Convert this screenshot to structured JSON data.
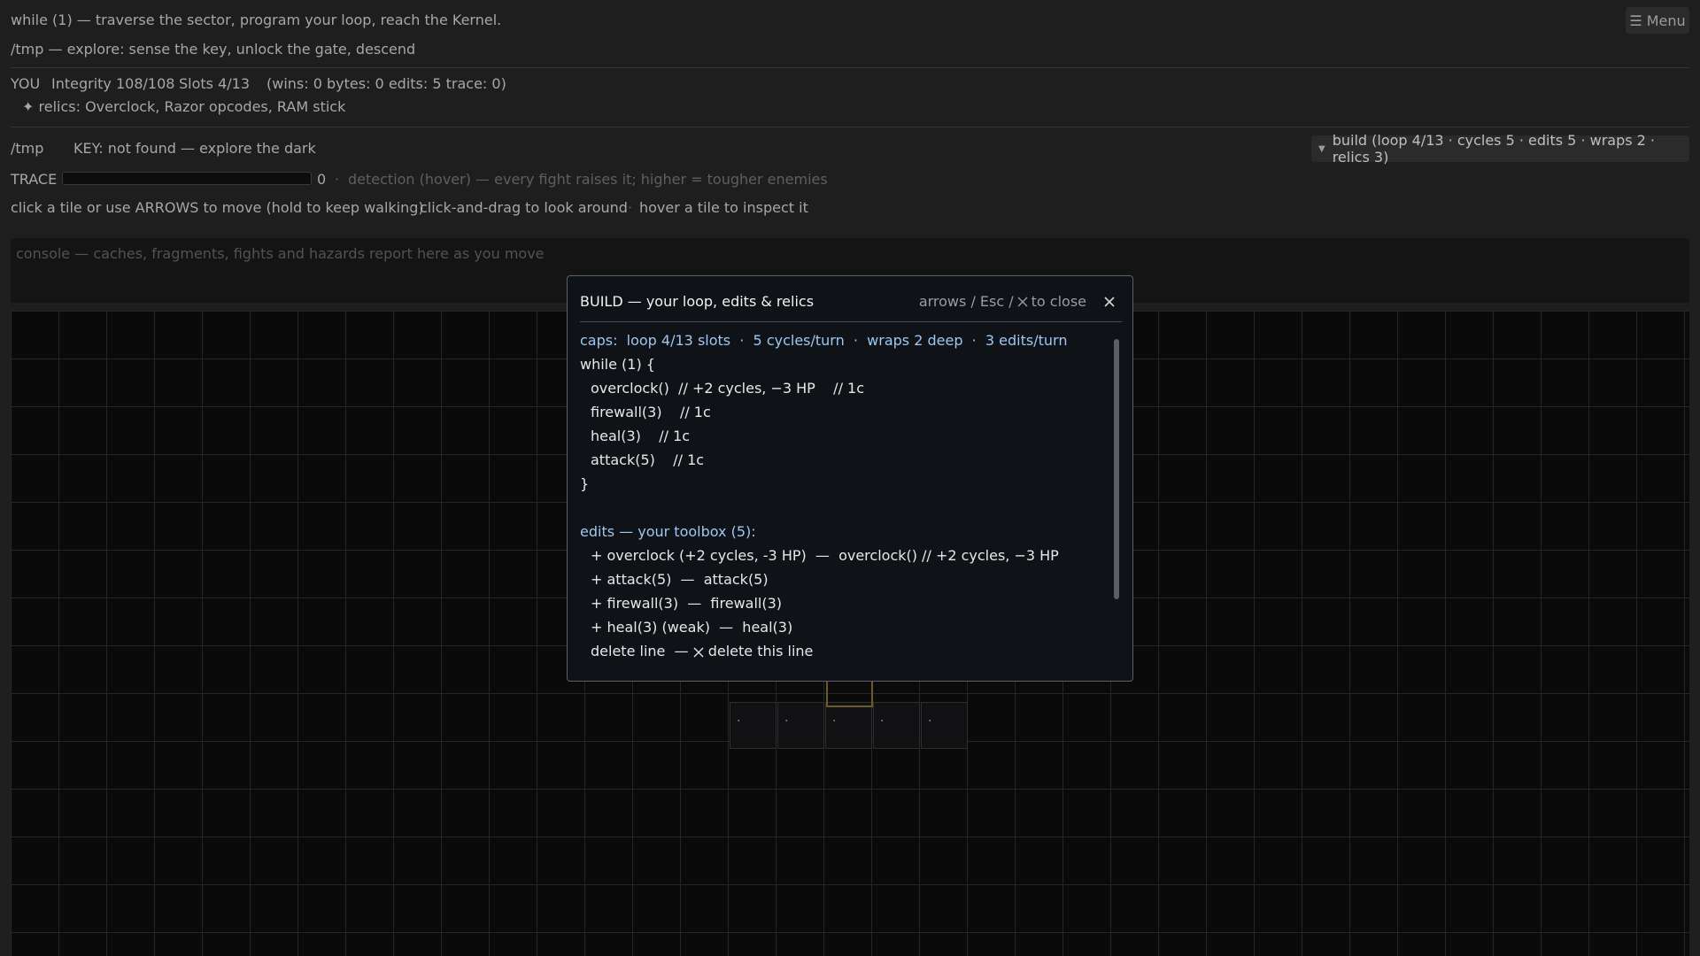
{
  "header": {
    "title_line": "while (1)  —  traverse the sector, program your loop, reach the Kernel.",
    "subtitle_line": "/tmp — explore: sense the key, unlock the gate, descend",
    "menu_label": "Menu"
  },
  "status": {
    "you": "YOU",
    "integrity": "Integrity 108/108",
    "slots": "Slots 4/13",
    "counters": "(wins: 0   bytes: 0   edits: 5   trace: 0)",
    "relics": "relics: Overclock, Razor opcodes, RAM stick"
  },
  "location": {
    "path": "/tmp",
    "key_status": "KEY: not found — explore the dark",
    "build_toggle": "build (loop 4/13 · cycles 5 · edits 5 · wraps 2 · relics 3)"
  },
  "trace": {
    "label": "TRACE",
    "value": "0",
    "level": 0,
    "hint": "detection (hover) — every fight raises it; higher = tougher enemies"
  },
  "help": {
    "move": "click a tile or use ARROWS to move (hold to keep walking)",
    "look": "click-and-drag to look around",
    "inspect": "hover a tile to inspect it",
    "sep": "·"
  },
  "console": {
    "placeholder": "console — caches, fragments, fights and hazards report here as you move"
  },
  "map": {
    "dots": [
      ".",
      ".",
      ".",
      ".",
      "."
    ]
  },
  "modal": {
    "title": "BUILD — your loop, edits & relics",
    "hint_prefix": "arrows / Esc /",
    "hint_suffix": "to close",
    "caps": "caps:  loop 4/13 slots  ·  5 cycles/turn  ·  wraps 2 deep  ·  3 edits/turn",
    "loop_open": "while (1) {",
    "loop_lines": [
      "overclock()  // +2 cycles, −3 HP    // 1c",
      "firewall(3)    // 1c",
      "heal(3)    // 1c",
      "attack(5)    // 1c"
    ],
    "loop_close": "}",
    "edits_header": "edits — your toolbox (5):",
    "edits": [
      "+ overclock (+2 cycles, -3 HP)  —  overclock() // +2 cycles, −3 HP",
      "+ attack(5)  —  attack(5)",
      "+ firewall(3)  —  firewall(3)",
      "+ heal(3) (weak)  —  heal(3)"
    ],
    "delete_prefix": "delete line  —",
    "delete_suffix": "delete this line"
  },
  "colors": {
    "background": "#1e1e1e",
    "map_background": "#0a0a0b",
    "modal_background": "#0f1216",
    "caps_blue": "#9ec7f2",
    "selected_tile": "#6b5b2c"
  },
  "icons": {
    "menu": "hamburger-icon",
    "relic": "sparkle-icon",
    "build_toggle": "triangle-down-icon",
    "close": "close-icon"
  }
}
